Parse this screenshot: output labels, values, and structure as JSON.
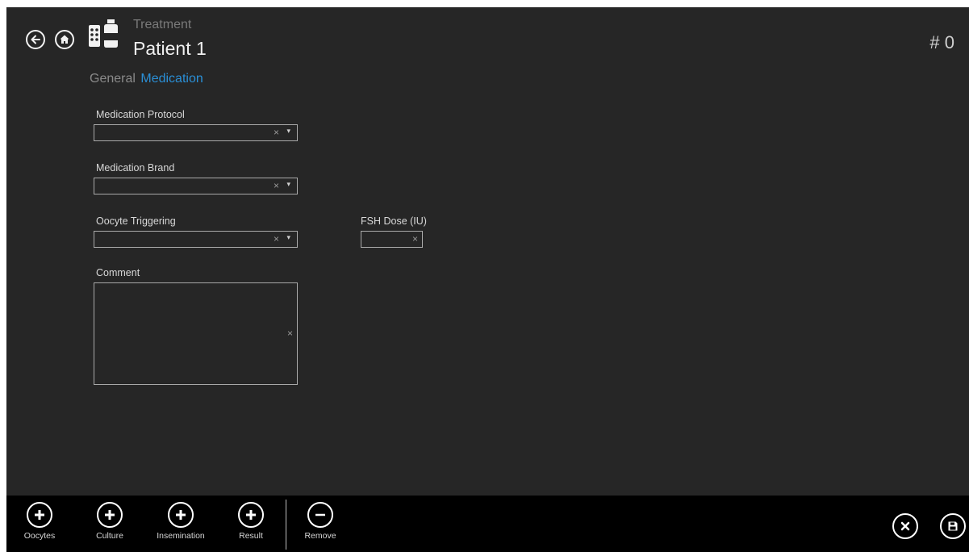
{
  "header": {
    "section": "Treatment",
    "title": "Patient 1",
    "counter": "# 0",
    "back_icon": "arrow-left-icon",
    "home_icon": "home-icon",
    "app_icon": "medication-icon"
  },
  "tabs": [
    {
      "label": "General",
      "active": false
    },
    {
      "label": "Medication",
      "active": true
    }
  ],
  "form": {
    "medication_protocol": {
      "label": "Medication Protocol",
      "value": ""
    },
    "medication_brand": {
      "label": "Medication Brand",
      "value": ""
    },
    "oocyte_triggering": {
      "label": "Oocyte Triggering",
      "value": ""
    },
    "fsh_dose": {
      "label": "FSH Dose (IU)",
      "value": ""
    },
    "comment": {
      "label": "Comment",
      "value": ""
    },
    "clear_glyph": "×",
    "dropdown_glyph": "▾"
  },
  "bottom_bar": {
    "add_items": [
      {
        "label": "Oocytes",
        "icon": "plus-circle-icon"
      },
      {
        "label": "Culture",
        "icon": "plus-circle-icon"
      },
      {
        "label": "Insemination",
        "icon": "plus-circle-icon"
      },
      {
        "label": "Result",
        "icon": "plus-circle-icon"
      }
    ],
    "remove": {
      "label": "Remove",
      "icon": "minus-circle-icon"
    },
    "cancel_icon": "close-circle-icon",
    "save_icon": "save-icon"
  },
  "colors": {
    "background": "#262626",
    "accent": "#2a8fd6",
    "bottom_bar": "#000000"
  }
}
